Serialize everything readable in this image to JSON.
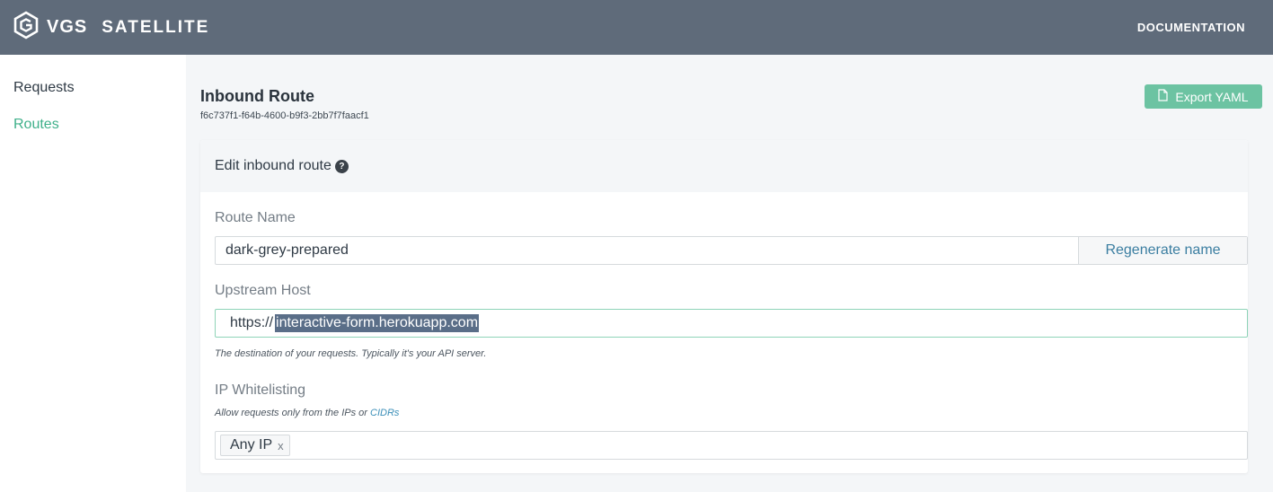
{
  "header": {
    "brand_name": "VGS",
    "product_name": "SATELLITE",
    "documentation_label": "DOCUMENTATION",
    "logo_icon": "vgs-hexagon-logo-icon",
    "background_color": "#5f6b7a"
  },
  "sidebar": {
    "items": [
      {
        "label": "Requests",
        "active": false
      },
      {
        "label": "Routes",
        "active": true
      }
    ],
    "active_color": "#3fb08a"
  },
  "main": {
    "title": "Inbound Route",
    "route_id": "f6c737f1-f64b-4600-b9f3-2bb7f7faacf1",
    "export_label": "Export YAML",
    "export_icon": "file-icon",
    "accent_color": "#6cc3a2"
  },
  "card": {
    "heading": "Edit inbound route",
    "help_icon": "question-circle-icon",
    "route_name": {
      "label": "Route Name",
      "value": "dark-grey-prepared",
      "regenerate_label": "Regenerate name"
    },
    "upstream_host": {
      "label": "Upstream Host",
      "prefix": "https://",
      "value": "interactive-form.herokuapp.com",
      "help": "The destination of your requests. Typically it's your API server."
    },
    "ip_whitelisting": {
      "label": "IP Whitelisting",
      "help_prefix": "Allow requests only from the IPs or",
      "help_link": "CIDRs",
      "tags": [
        {
          "label": "Any IP",
          "remove": "x"
        }
      ]
    }
  }
}
